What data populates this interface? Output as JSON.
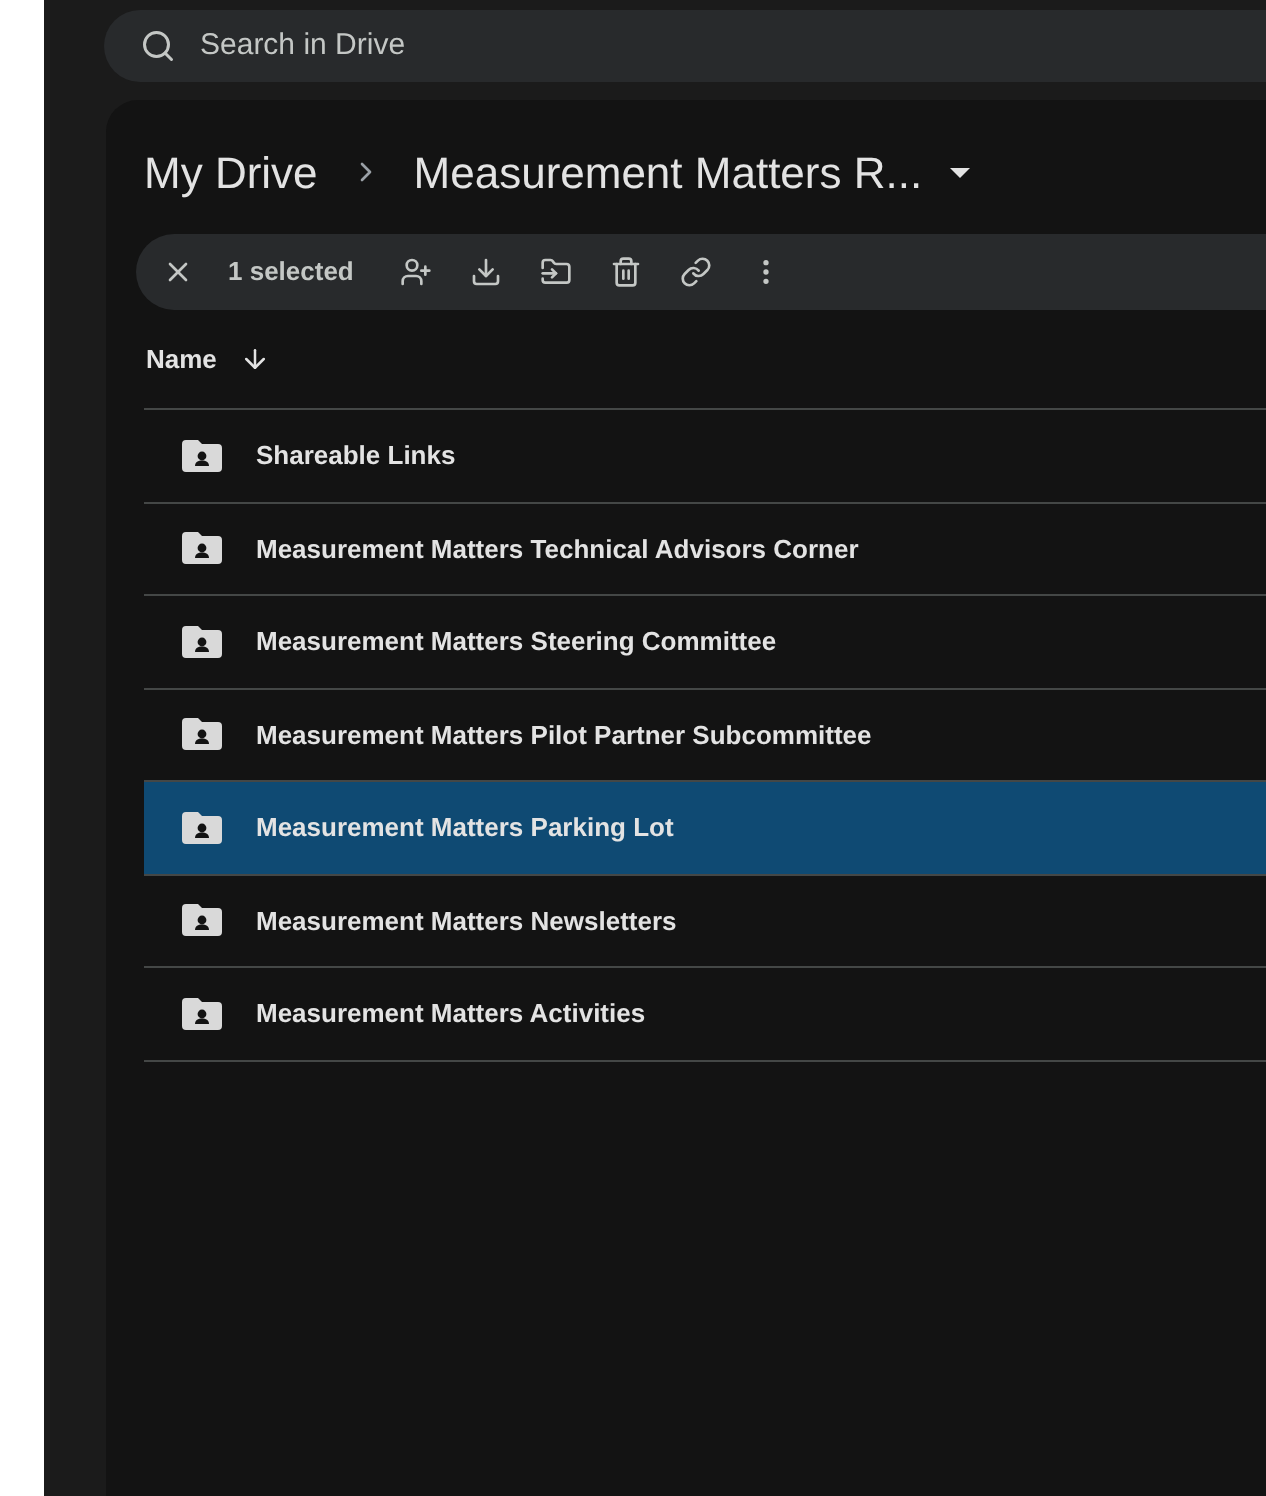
{
  "search": {
    "placeholder": "Search in Drive"
  },
  "breadcrumb": [
    {
      "label": "My Drive"
    },
    {
      "label": "Measurement Matters R..."
    }
  ],
  "selection_bar": {
    "count": "1 selected"
  },
  "table": {
    "columns": [
      {
        "label": "Name"
      }
    ],
    "rows": [
      {
        "name": "Shareable Links",
        "selected": false
      },
      {
        "name": "Measurement Matters Technical Advisors Corner",
        "selected": false
      },
      {
        "name": "Measurement Matters Steering Committee",
        "selected": false
      },
      {
        "name": "Measurement Matters Pilot Partner Subcommittee",
        "selected": false
      },
      {
        "name": "Measurement Matters Parking Lot",
        "selected": true
      },
      {
        "name": "Measurement Matters Newsletters",
        "selected": false
      },
      {
        "name": "Measurement Matters Activities",
        "selected": false
      }
    ]
  }
}
